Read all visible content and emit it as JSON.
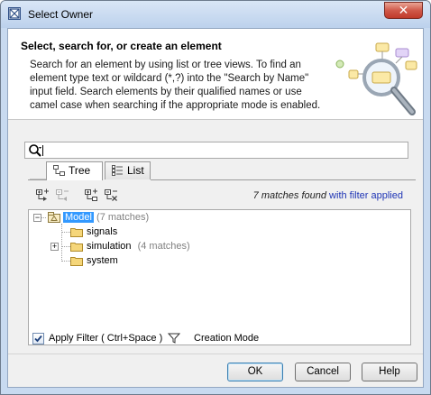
{
  "window": {
    "title": "Select Owner",
    "close_glyph": "✕"
  },
  "header": {
    "title": "Select, search for, or create an element",
    "description": "Search for an element by using list or tree views. To find an element type text or wildcard (*,?) into the \"Search by Name\" input field. Search elements by their qualified names or use camel case when searching if the appropriate mode is enabled."
  },
  "search": {
    "value": "",
    "icon": "search-icon"
  },
  "tabs": [
    {
      "label": "Tree",
      "icon": "tree-view-icon",
      "selected": true
    },
    {
      "label": "List",
      "icon": "list-view-icon",
      "selected": false
    }
  ],
  "toolbar": {
    "icons": [
      "expand-all-icon",
      "collapse-all-icon",
      "expand-selected-icon",
      "collapse-selected-icon"
    ],
    "match_count": "7 matches found",
    "match_filter": " with filter applied"
  },
  "tree": {
    "root": {
      "label": "Model",
      "count": "(7 matches)"
    },
    "children": [
      {
        "label": "signals",
        "count": ""
      },
      {
        "label": "simulation",
        "count": "(4 matches)"
      },
      {
        "label": "system",
        "count": ""
      }
    ]
  },
  "options": {
    "apply_filter_label": "Apply Filter ( Ctrl+Space )",
    "apply_filter_checked": true,
    "creation_mode_label": "Creation Mode"
  },
  "buttons": {
    "ok": "OK",
    "cancel": "Cancel",
    "help": "Help"
  },
  "colors": {
    "selection": "#3399ff",
    "link": "#1f35b5",
    "folder": "#f5d67a"
  }
}
